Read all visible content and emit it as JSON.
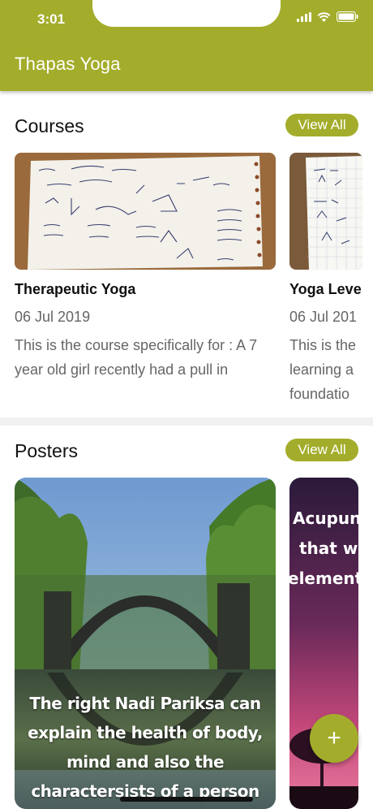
{
  "status_bar": {
    "time": "3:01",
    "icons": [
      "signal-icon",
      "wifi-icon",
      "battery-icon"
    ]
  },
  "app_bar": {
    "title": "Thapas Yoga",
    "color": "#a3ad2b"
  },
  "courses": {
    "title": "Courses",
    "view_all": "View All",
    "items": [
      {
        "title": "Therapeutic Yoga",
        "date": "06 Jul 2019",
        "description": "This is the course specifically for : A 7 year old girl recently had a pull in"
      },
      {
        "title": "Yoga Leve",
        "date": "06 Jul 201",
        "description": "This is the learning a foundatio"
      }
    ]
  },
  "posters": {
    "title": "Posters",
    "view_all": "View All",
    "items": [
      {
        "text": "The right Nadi Pariksa can explain the health of body, mind and also the charactersists of a person"
      },
      {
        "lines": [
          "Acupunct",
          "that wo",
          "elements a"
        ]
      }
    ]
  },
  "fab": {
    "label": "+"
  }
}
